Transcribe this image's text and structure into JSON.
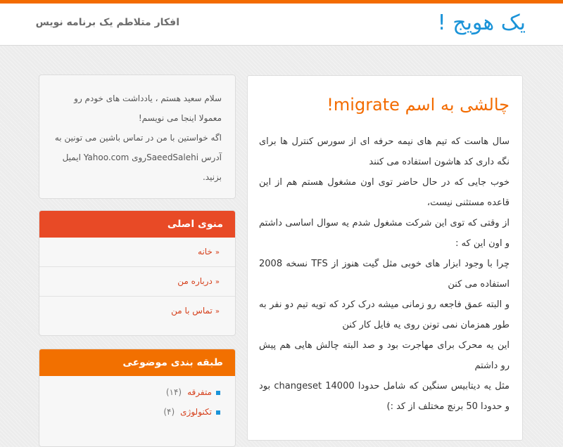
{
  "header": {
    "site_title": "یک هویج !",
    "tagline": "افکار متلاطم یک برنامه نویس"
  },
  "post": {
    "title": "چالشی به اسم migrate!",
    "paragraphs": [
      "سال هاست که تیم های نیمه حرفه ای از سورس کنترل ها برای نگه داری کد هاشون استفاده می کنند",
      "خوب جایی که در حال حاضر توی اون مشغول هستم هم از این قاعده مستثنی نیست،",
      "از وقتی که توی این شرکت مشغول شدم یه سوال اساسی داشتم و اون این که :",
      "چرا با وجود ابزار های خوبی مثل گیت هنوز از TFS نسخه 2008 استفاده می کنن",
      "و البته عمق فاجعه رو زمانی میشه درک کرد که تویه تیم دو نفر به طور همزمان نمی تونن روی یه فایل کار کنن",
      "این یه محرک برای مهاجرت بود و صد البته چالش هایی هم پیش رو داشتم",
      "مثل یه دیتابیس سنگین که شامل حدودا changeset 14000 بود و حدودا 50 برنچ مختلف از کد :)"
    ]
  },
  "about": {
    "lines": [
      "سلام سعید هستم ، یادداشت های خودم رو معمولا اینجا می نویسم!",
      "اگه خواستین با من در تماس باشین می تونین به آدرس SaeedSalehiروی Yahoo.com ایمیل بزنید."
    ]
  },
  "menu_widget": {
    "title": "منوی اصلی",
    "items": [
      {
        "label": "خانه"
      },
      {
        "label": "درباره من"
      },
      {
        "label": "تماس با من"
      }
    ]
  },
  "category_widget": {
    "title": "طبقه بندی موضوعی",
    "items": [
      {
        "label": "متفرقه",
        "count": "(۱۴)"
      },
      {
        "label": "تکنولوژی",
        "count": "(۴)"
      }
    ]
  },
  "colors": {
    "accent_orange": "#f36b00",
    "menu_red": "#e84a26",
    "title_blue": "#1a93d8"
  }
}
